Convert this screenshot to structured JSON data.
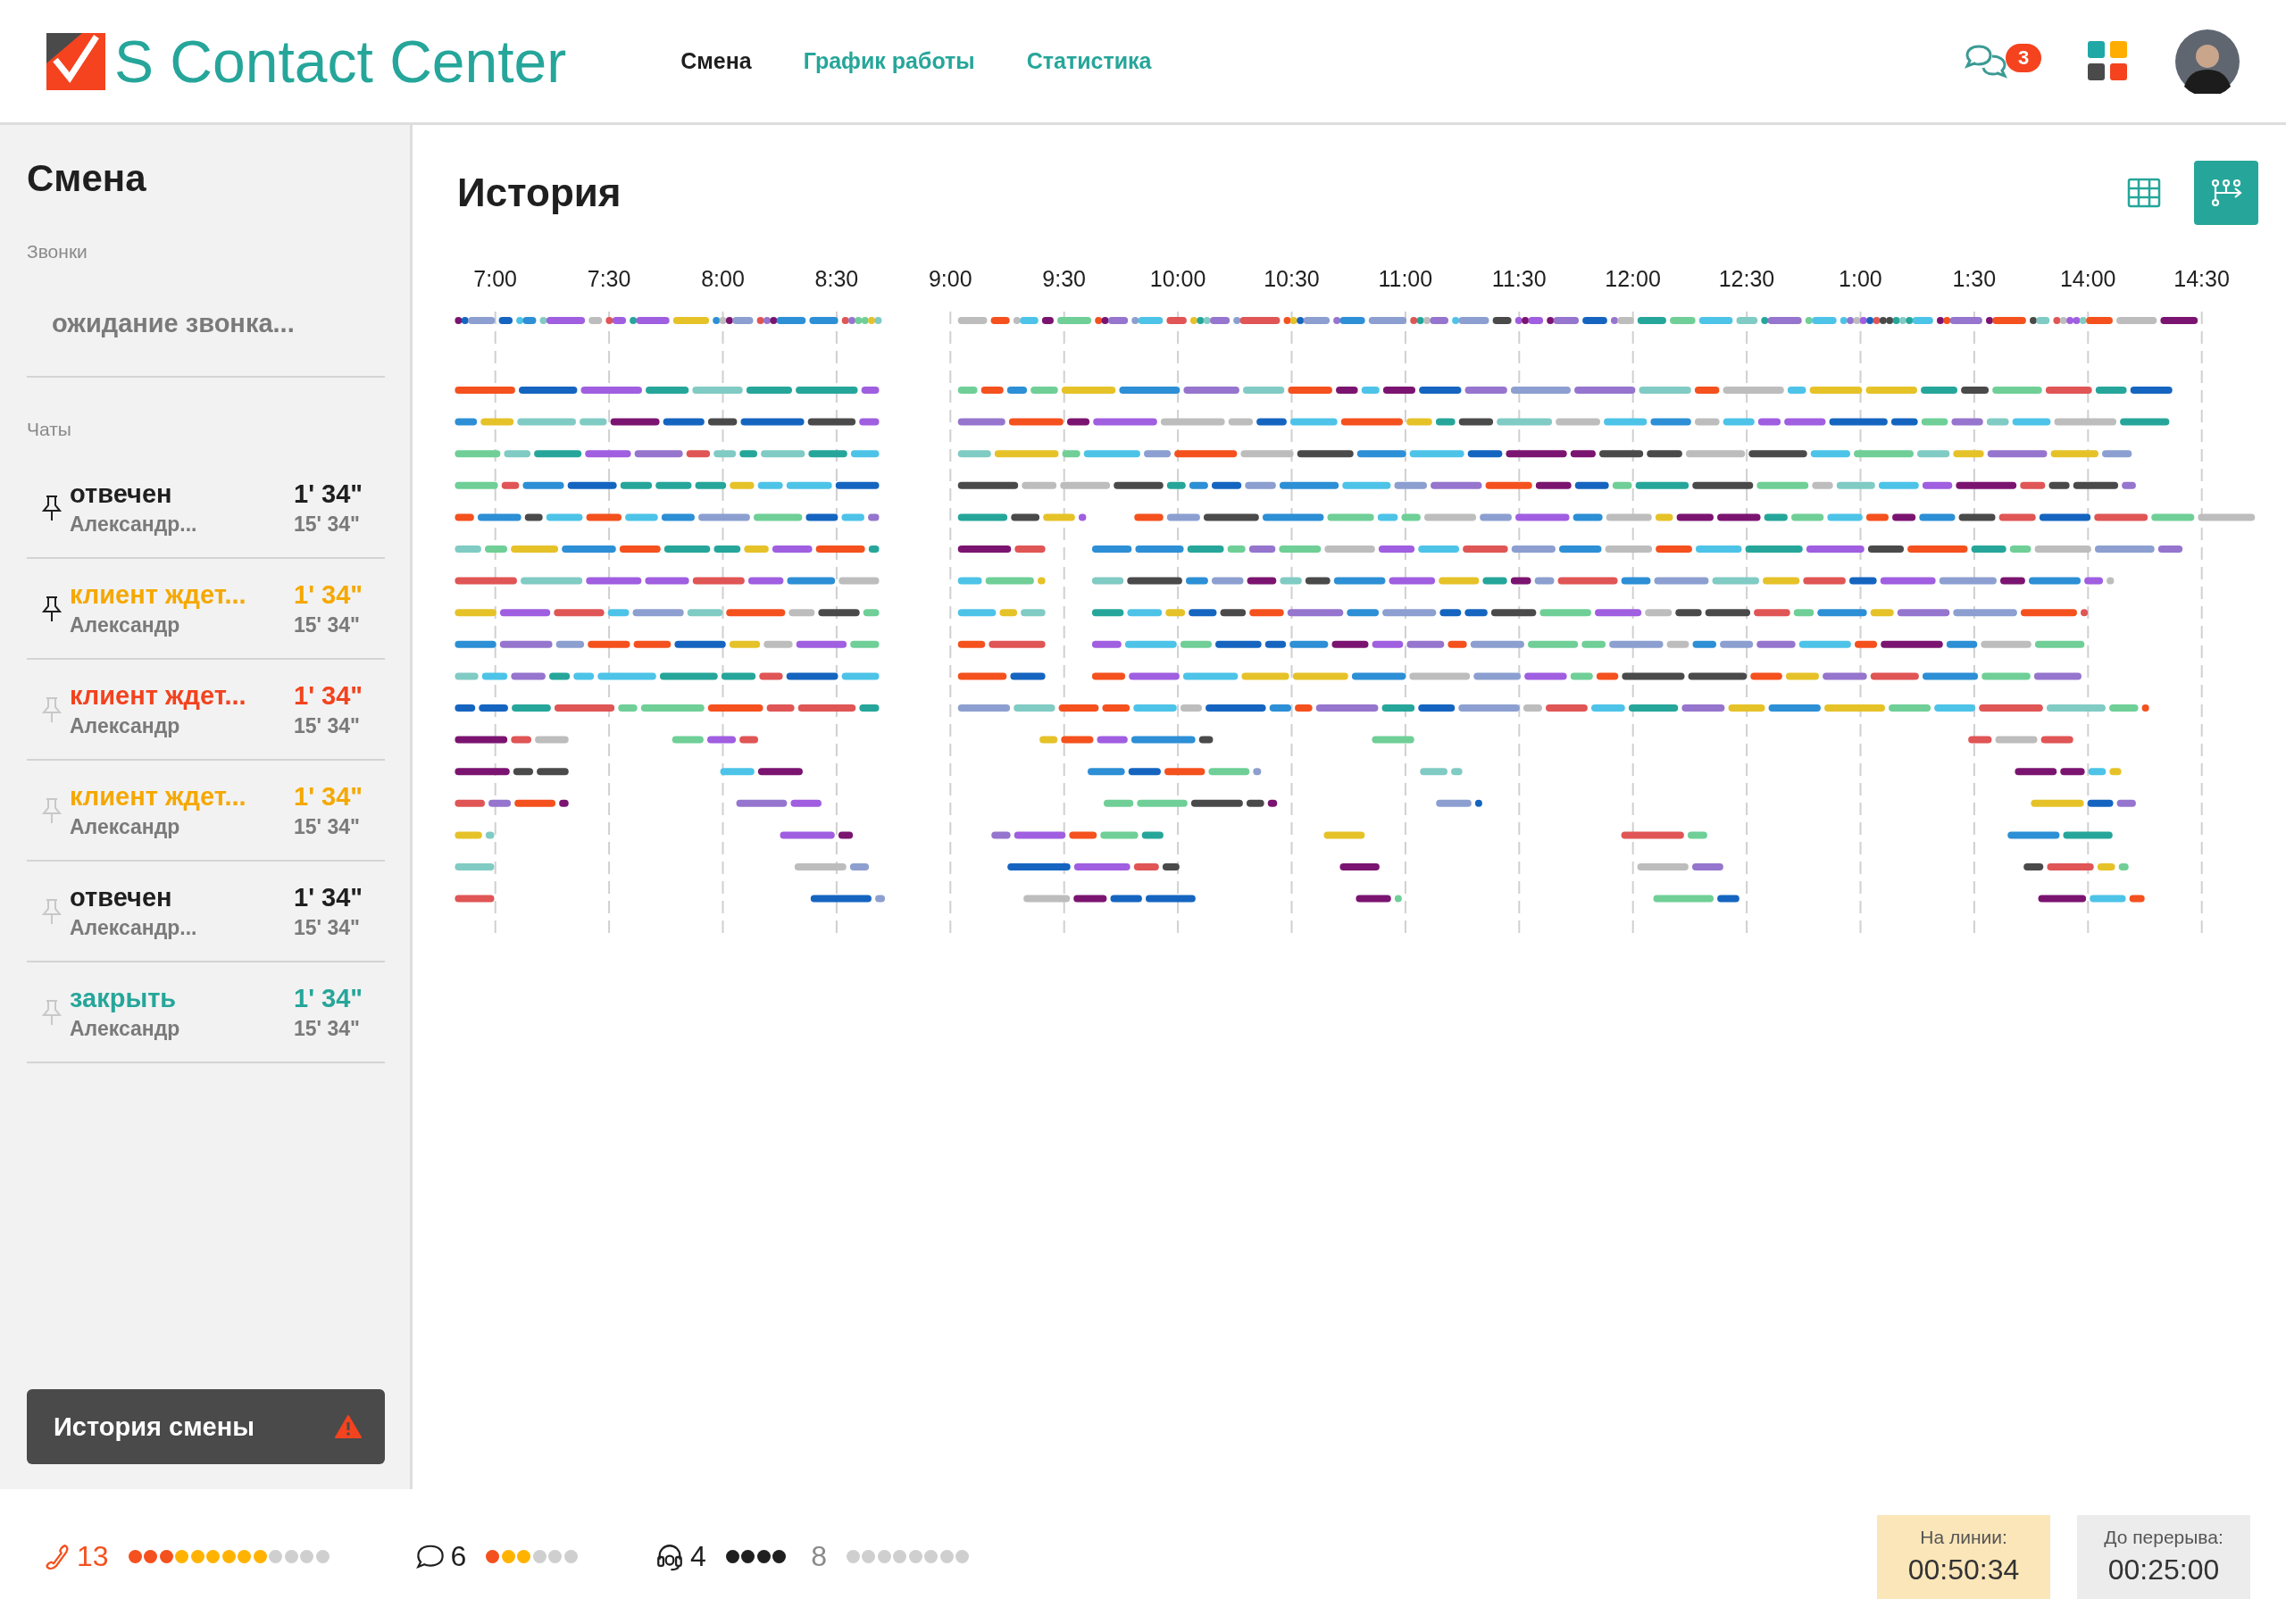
{
  "header": {
    "logo_text": "S Contact Center",
    "nav": [
      {
        "label": "Смена",
        "selected": true
      },
      {
        "label": "График работы",
        "selected": false
      },
      {
        "label": "Статистика",
        "selected": false
      }
    ],
    "messages_badge": "3"
  },
  "sidebar": {
    "title": "Смена",
    "calls_label": "Звонки",
    "call_status": "ожидание звонка...",
    "chats_label": "Чаты",
    "chats": [
      {
        "status": "отвечен",
        "name": "Александр...",
        "time": "1' 34\"",
        "total": "15' 34\"",
        "color": "#1f1f1f",
        "pinned": true
      },
      {
        "status": "клиент ждет...",
        "name": "Александр",
        "time": "1' 34\"",
        "total": "15' 34\"",
        "color": "#f5a800",
        "pinned": true
      },
      {
        "status": "клиент ждет...",
        "name": "Александр",
        "time": "1' 34\"",
        "total": "15' 34\"",
        "color": "#f2431e",
        "pinned": false
      },
      {
        "status": "клиент ждет...",
        "name": "Александр",
        "time": "1' 34\"",
        "total": "15' 34\"",
        "color": "#f5a800",
        "pinned": false
      },
      {
        "status": "отвечен",
        "name": "Александр...",
        "time": "1' 34\"",
        "total": "15' 34\"",
        "color": "#1f1f1f",
        "pinned": false
      },
      {
        "status": "закрыть",
        "name": "Александр",
        "time": "1' 34\"",
        "total": "15' 34\"",
        "color": "#26a69a",
        "pinned": false
      }
    ],
    "history_button": "История смены"
  },
  "main": {
    "title": "История",
    "view_buttons": [
      {
        "kind": "grid",
        "selected": false
      },
      {
        "kind": "flow",
        "selected": true
      }
    ],
    "ticks": [
      "7:00",
      "7:30",
      "8:00",
      "8:30",
      "9:00",
      "9:30",
      "10:00",
      "10:30",
      "11:00",
      "11:30",
      "12:00",
      "12:30",
      "1:00",
      "1:30",
      "14:00",
      "14:30"
    ]
  },
  "status_bar": {
    "groups": [
      {
        "kind": "calls",
        "count": "13",
        "dots": [
          {
            "color": "#f4511e"
          },
          {
            "color": "#f4511e"
          },
          {
            "color": "#f4511e"
          },
          {
            "color": "#ffb300"
          },
          {
            "color": "#ffb300"
          },
          {
            "color": "#ffb300"
          },
          {
            "color": "#ffb300"
          },
          {
            "color": "#ffb300"
          },
          {
            "color": "#ffb300"
          },
          {
            "color": "#cfcfcf"
          },
          {
            "color": "#cfcfcf"
          },
          {
            "color": "#cfcfcf"
          },
          {
            "color": "#cfcfcf"
          }
        ]
      },
      {
        "kind": "chats",
        "count": "6",
        "dots": [
          {
            "color": "#f4511e"
          },
          {
            "color": "#ffb300"
          },
          {
            "color": "#ffb300"
          },
          {
            "color": "#cfcfcf"
          },
          {
            "color": "#cfcfcf"
          },
          {
            "color": "#cfcfcf"
          }
        ]
      },
      {
        "kind": "operators",
        "count": "4",
        "dots": [
          {
            "color": "#1f1f1f"
          },
          {
            "color": "#1f1f1f"
          },
          {
            "color": "#1f1f1f"
          },
          {
            "color": "#1f1f1f"
          }
        ]
      },
      {
        "kind": "idle",
        "count": "8",
        "dots": [
          {
            "color": "#cfcfcf"
          },
          {
            "color": "#cfcfcf"
          },
          {
            "color": "#cfcfcf"
          },
          {
            "color": "#cfcfcf"
          },
          {
            "color": "#cfcfcf"
          },
          {
            "color": "#cfcfcf"
          },
          {
            "color": "#cfcfcf"
          },
          {
            "color": "#cfcfcf"
          }
        ]
      }
    ],
    "timers": [
      {
        "label": "На линии:",
        "value": "00:50:34",
        "highlighted": true
      },
      {
        "label": "До перерыва:",
        "value": "00:25:00",
        "highlighted": false
      }
    ]
  }
}
